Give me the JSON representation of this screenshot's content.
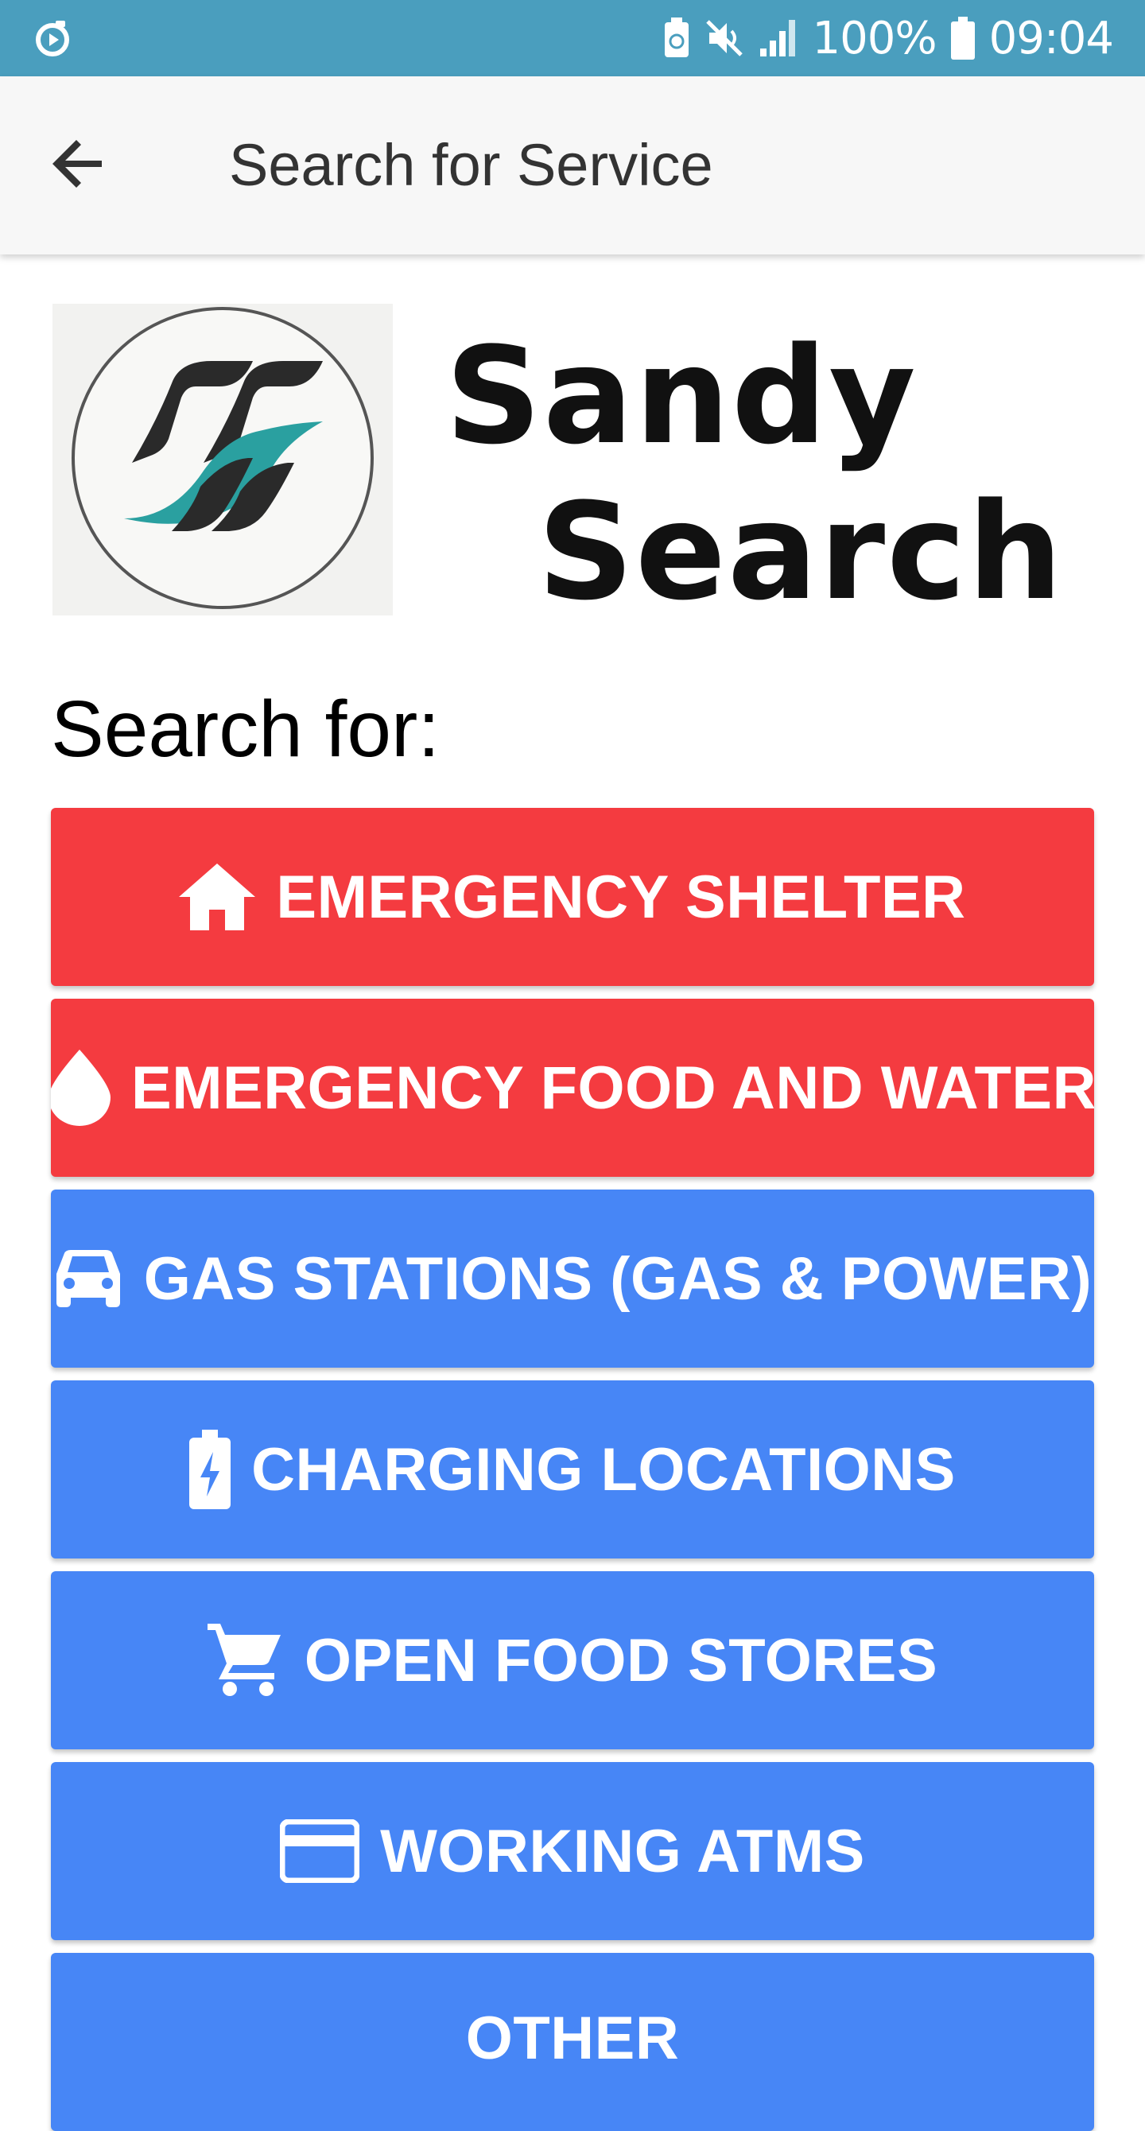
{
  "status_bar": {
    "battery_percent": "100%",
    "time": "09:04",
    "icons": [
      "app-notification-icon",
      "battery-saver-icon",
      "mute-icon",
      "signal-icon",
      "battery-icon"
    ]
  },
  "app_bar": {
    "back_icon": "arrow-back-icon",
    "title": "Search for Service"
  },
  "logo": {
    "line1": "Sandy",
    "line2": "Search"
  },
  "heading": "Search for:",
  "colors": {
    "status_bar": "#4a9ebe",
    "emergency": "#f43b40",
    "service": "#4786f6"
  },
  "buttons": [
    {
      "label": "EMERGENCY SHELTER",
      "icon": "home-icon"
    },
    {
      "label": "EMERGENCY FOOD AND WATER",
      "icon": "water-drop-icon"
    },
    {
      "label": "GAS STATIONS (GAS & POWER)",
      "icon": "car-icon"
    },
    {
      "label": "CHARGING LOCATIONS",
      "icon": "battery-charging-icon"
    },
    {
      "label": "OPEN FOOD STORES",
      "icon": "cart-icon"
    },
    {
      "label": "WORKING ATMS",
      "icon": "credit-card-icon"
    },
    {
      "label": "OTHER",
      "icon": ""
    }
  ]
}
